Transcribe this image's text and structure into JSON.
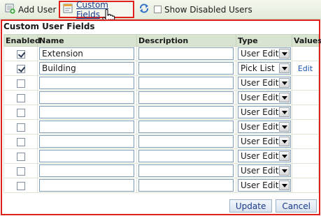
{
  "toolbar": {
    "add_user_label": "Add User",
    "custom_fields_label": "Custom Fields",
    "show_disabled_label": "Show Disabled Users"
  },
  "panel": {
    "title": "Custom User Fields",
    "columns": {
      "enabled": "Enabled",
      "name": "Name",
      "description": "Description",
      "type": "Type",
      "values": "Values"
    },
    "rows": [
      {
        "enabled": true,
        "name": "Extension",
        "description": "",
        "type": "User Edit",
        "values_link": ""
      },
      {
        "enabled": true,
        "name": "Building",
        "description": "",
        "type": "Pick List",
        "values_link": "Edit"
      },
      {
        "enabled": false,
        "name": "",
        "description": "",
        "type": "User Edit",
        "values_link": ""
      },
      {
        "enabled": false,
        "name": "",
        "description": "",
        "type": "User Edit",
        "values_link": ""
      },
      {
        "enabled": false,
        "name": "",
        "description": "",
        "type": "User Edit",
        "values_link": ""
      },
      {
        "enabled": false,
        "name": "",
        "description": "",
        "type": "User Edit",
        "values_link": ""
      },
      {
        "enabled": false,
        "name": "",
        "description": "",
        "type": "User Edit",
        "values_link": ""
      },
      {
        "enabled": false,
        "name": "",
        "description": "",
        "type": "User Edit",
        "values_link": ""
      },
      {
        "enabled": false,
        "name": "",
        "description": "",
        "type": "User Edit",
        "values_link": ""
      },
      {
        "enabled": false,
        "name": "",
        "description": "",
        "type": "User Edit",
        "values_link": ""
      }
    ],
    "update_label": "Update",
    "cancel_label": "Cancel"
  },
  "colors": {
    "highlight_border": "#e0201a",
    "header_bg": "#d8e4cf",
    "link": "#1a55b0"
  },
  "icons": {
    "add_user": "add-user-icon",
    "custom_fields": "custom-fields-icon",
    "refresh": "refresh-icon",
    "cursor": "hand-pointer-icon"
  }
}
